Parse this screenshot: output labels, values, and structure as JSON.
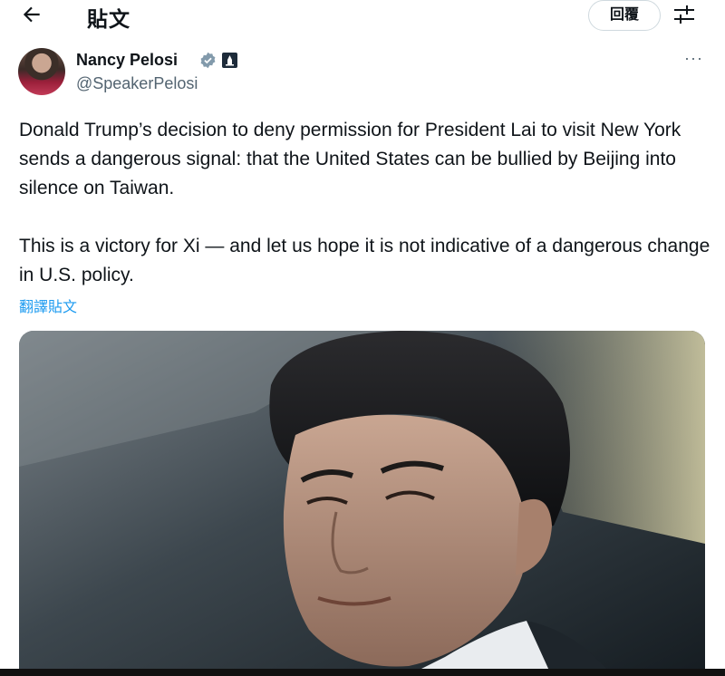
{
  "header": {
    "title": "貼文",
    "reply_label": "回覆"
  },
  "tweet": {
    "author_name": "Nancy Pelosi",
    "author_handle": "@SpeakerPelosi",
    "paragraphs": [
      "Donald Trump’s decision to deny permission for President Lai to visit New York sends a dangerous signal: that the United States can be bullied by Beijing into silence on Taiwan.",
      "This is a victory for Xi — and let us hope it is not indicative of a dangerous change in U.S. policy."
    ],
    "translate_label": "翻譯貼文",
    "more_label": "···"
  },
  "icons": {
    "back": "arrow-left-icon",
    "filter": "sliders-icon",
    "verified": "verified-badge-icon",
    "affiliation": "government-building-icon"
  },
  "colors": {
    "link": "#1d9bf0",
    "verified_badge": "#829aab",
    "secondary_text": "#536471"
  }
}
